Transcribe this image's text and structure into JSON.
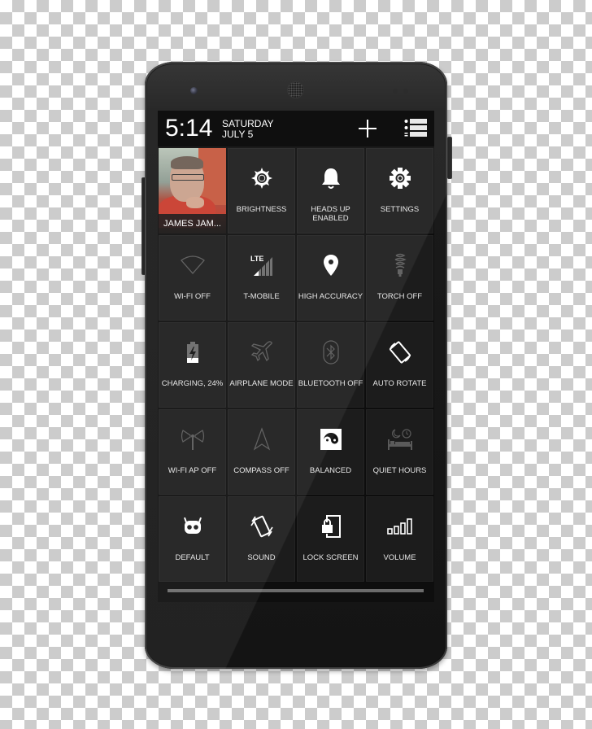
{
  "device": {
    "type": "smartphone"
  },
  "status_header": {
    "time": "5:14",
    "day": "SATURDAY",
    "date": "JULY 5",
    "add_button": "add-icon",
    "edit_tiles_button": "list-icon"
  },
  "profile_tile": {
    "name": "JAMES JAM..."
  },
  "tiles": [
    {
      "label": "BRIGHTNESS",
      "icon": "brightness-icon",
      "active": true
    },
    {
      "label": "HEADS UP ENABLED",
      "icon": "bell-icon",
      "active": true
    },
    {
      "label": "SETTINGS",
      "icon": "gear-icon",
      "active": true
    },
    {
      "label": "WI-FI OFF",
      "icon": "wifi-icon",
      "active": false
    },
    {
      "label": "T-MOBILE",
      "icon": "lte-signal-icon",
      "active": true,
      "badge": "LTE"
    },
    {
      "label": "HIGH ACCURACY",
      "icon": "location-pin-icon",
      "active": true
    },
    {
      "label": "TORCH OFF",
      "icon": "torch-bulb-icon",
      "active": false
    },
    {
      "label": "CHARGING, 24%",
      "icon": "battery-charging-icon",
      "active": true,
      "battery_percent": 24
    },
    {
      "label": "AIRPLANE MODE",
      "icon": "airplane-icon",
      "active": false
    },
    {
      "label": "BLUETOOTH OFF",
      "icon": "bluetooth-icon",
      "active": false
    },
    {
      "label": "AUTO ROTATE",
      "icon": "auto-rotate-icon",
      "active": true
    },
    {
      "label": "WI-FI AP OFF",
      "icon": "hotspot-icon",
      "active": false
    },
    {
      "label": "COMPASS OFF",
      "icon": "compass-arrow-icon",
      "active": false
    },
    {
      "label": "BALANCED",
      "icon": "yin-yang-chip-icon",
      "active": true
    },
    {
      "label": "QUIET HOURS",
      "icon": "bed-clock-icon",
      "active": false
    },
    {
      "label": "DEFAULT",
      "icon": "cyanogenmod-icon",
      "active": true
    },
    {
      "label": "SOUND",
      "icon": "vibrate-phone-icon",
      "active": true
    },
    {
      "label": "LOCK SCREEN",
      "icon": "lock-screen-icon",
      "active": true
    },
    {
      "label": "VOLUME",
      "icon": "volume-bars-icon",
      "active": true
    }
  ],
  "colors": {
    "active_icon": "#ffffff",
    "inactive_icon": "#5a5a5a",
    "tile_bg": "#1c1c1c",
    "header_bg": "#000000"
  }
}
